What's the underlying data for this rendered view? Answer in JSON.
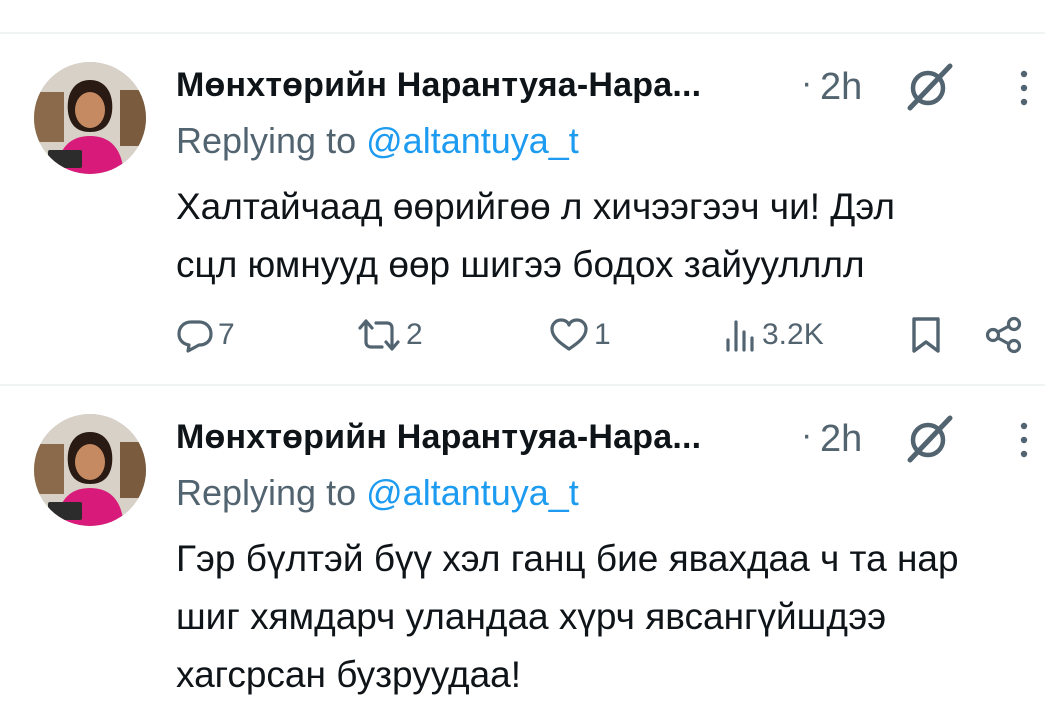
{
  "tweets": [
    {
      "author_name": "Мөнхтөрийн Нарантуяа-Нара...",
      "separator": "·",
      "time": "2h",
      "replying_prefix": "Replying to",
      "replying_handle": "@altantuya_t",
      "text_lines": [
        "Халтайчаад өөрийгөө л хичээгээч чи! Дэл",
        "сцл юмнууд өөр шигээ бодох зайуулллл"
      ],
      "replies": "7",
      "reposts": "2",
      "likes": "1",
      "views": "3.2K",
      "icons": [
        "avatar",
        "grok-icon",
        "more-icon",
        "reply-icon",
        "repost-icon",
        "like-icon",
        "views-icon",
        "bookmark-icon",
        "share-icon"
      ]
    },
    {
      "author_name": "Мөнхтөрийн Нарантуяа-Нара...",
      "separator": "·",
      "time": "2h",
      "replying_prefix": "Replying to",
      "replying_handle": "@altantuya_t",
      "text_lines": [
        "Гэр бүлтэй бүү хэл ганц бие явахдаа ч та нар",
        "шиг хямдарч уландаа хүрч явсангүйшдээ",
        "хагсрсан бузруудаа!"
      ]
    }
  ],
  "colors": {
    "text": "#0f1419",
    "muted": "#536471",
    "link": "#1d9bf0",
    "divider": "#eff3f4",
    "avatar_shirt": "#d81b7a"
  }
}
